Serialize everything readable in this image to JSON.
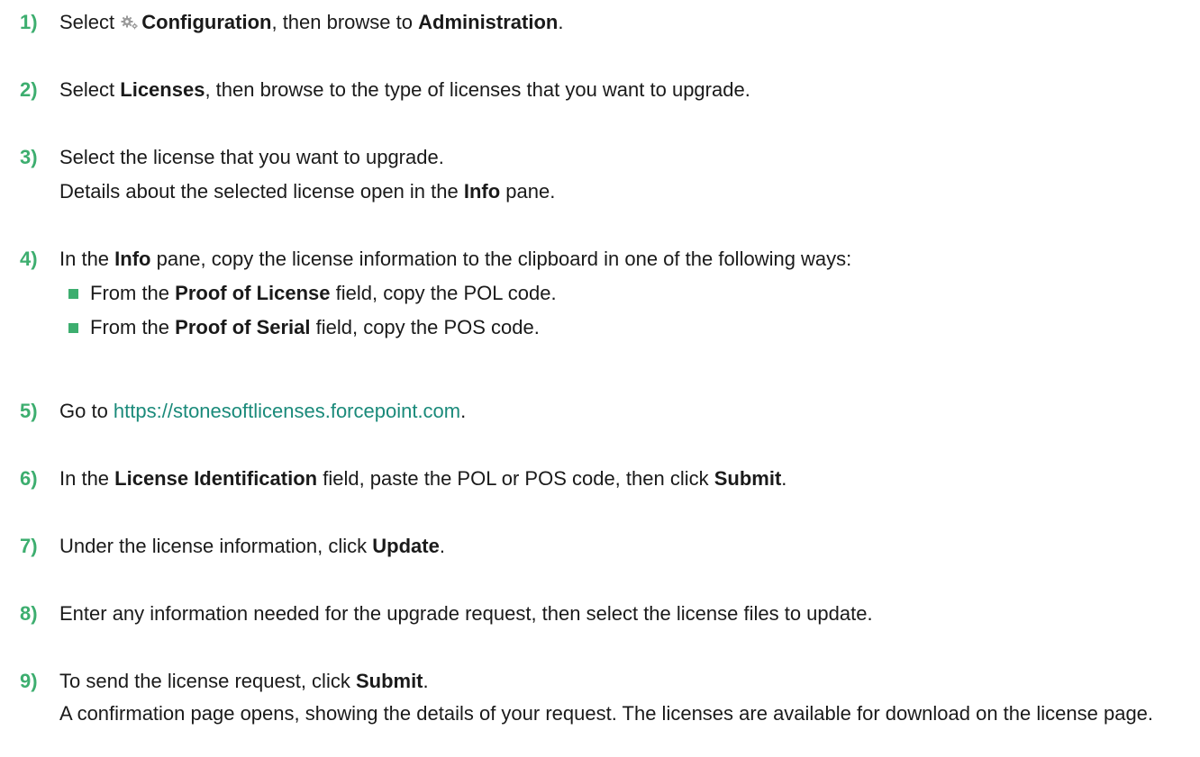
{
  "steps": [
    {
      "number": "1)",
      "parts": {
        "t1": "Select ",
        "icon": "gear-icon",
        "b1": "Configuration",
        "t2": ", then browse to ",
        "b2": "Administration",
        "t3": "."
      }
    },
    {
      "number": "2)",
      "parts": {
        "t1": "Select ",
        "b1": "Licenses",
        "t2": ", then browse to the type of licenses that you want to upgrade."
      }
    },
    {
      "number": "3)",
      "parts": {
        "t1": "Select the license that you want to upgrade.",
        "t2": "Details about the selected license open in the ",
        "b1": "Info",
        "t3": " pane."
      }
    },
    {
      "number": "4)",
      "parts": {
        "t1": "In the ",
        "b1": "Info",
        "t2": " pane, copy the license information to the clipboard in one of the following ways:"
      },
      "bullets": [
        {
          "t1": "From the ",
          "b1": "Proof of License",
          "t2": " field, copy the POL code."
        },
        {
          "t1": "From the ",
          "b1": "Proof of Serial",
          "t2": " field, copy the POS code."
        }
      ]
    },
    {
      "number": "5)",
      "parts": {
        "t1": "Go to ",
        "link": "https://stonesoftlicenses.forcepoint.com",
        "t2": "."
      }
    },
    {
      "number": "6)",
      "parts": {
        "t1": "In the ",
        "b1": "License Identification",
        "t2": " field, paste the POL or POS code, then click ",
        "b2": "Submit",
        "t3": "."
      }
    },
    {
      "number": "7)",
      "parts": {
        "t1": "Under the license information, click ",
        "b1": "Update",
        "t2": "."
      }
    },
    {
      "number": "8)",
      "parts": {
        "t1": "Enter any information needed for the upgrade request, then select the license files to update."
      }
    },
    {
      "number": "9)",
      "parts": {
        "t1": "To send the license request, click ",
        "b1": "Submit",
        "t2": ".",
        "t3": "A confirmation page opens, showing the details of your request. The licenses are available for download on the license page."
      }
    }
  ],
  "colors": {
    "step_number": "#3dae6f",
    "link": "#1a8a7a",
    "bullet": "#3dae6f"
  }
}
